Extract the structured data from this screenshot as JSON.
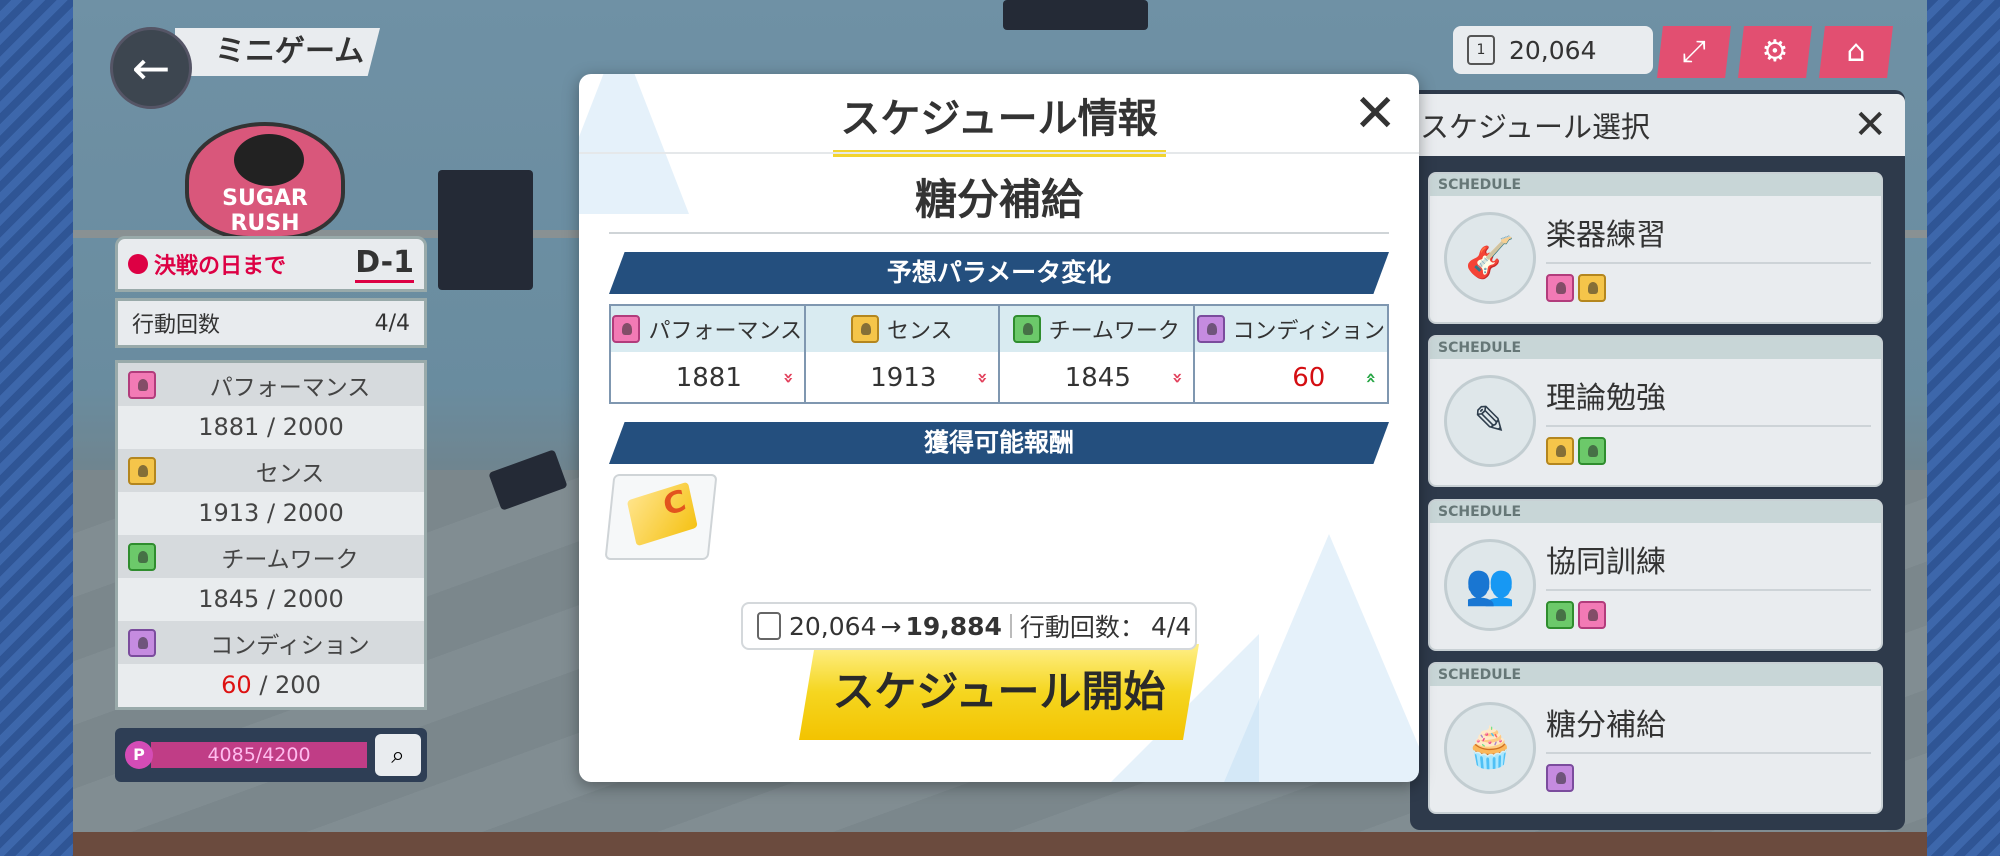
{
  "header": {
    "back_icon": "back-arrow-icon",
    "title": "ミニゲーム",
    "logo_text": "SUGAR RUSH"
  },
  "status": {
    "deadline_label": "決戦の日まで",
    "deadline_value": "D-1",
    "actions_label": "行動回数",
    "actions_value": "4/4",
    "stats": [
      {
        "label": "パフォーマンス",
        "current": "1881",
        "max": "2000"
      },
      {
        "label": "センス",
        "current": "1913",
        "max": "2000"
      },
      {
        "label": "チームワーク",
        "current": "1845",
        "max": "2000"
      },
      {
        "label": "コンディション",
        "current": "60",
        "max": "200"
      }
    ],
    "points_icon_label": "P",
    "points_value": "4085/4200",
    "points_progress": 0.9726
  },
  "top_right": {
    "currency": "20,064",
    "buttons": [
      "expand-icon",
      "gear-icon",
      "home-icon"
    ]
  },
  "schedule_select": {
    "title": "スケジュール選択",
    "tag": "SCHEDULE",
    "items": [
      {
        "name": "楽器練習",
        "icon": "guitar-icon",
        "params": [
          "performance",
          "sense"
        ]
      },
      {
        "name": "理論勉強",
        "icon": "book-pen-icon",
        "params": [
          "sense",
          "teamwork"
        ]
      },
      {
        "name": "協同訓練",
        "icon": "people-icon",
        "params": [
          "teamwork",
          "performance"
        ]
      },
      {
        "name": "糖分補給",
        "icon": "cupcake-icon",
        "params": [
          "condition"
        ]
      }
    ]
  },
  "modal": {
    "title": "スケジュール情報",
    "schedule_name": "糖分補給",
    "param_banner": "予想パラメータ変化",
    "params": [
      {
        "label": "パフォーマンス",
        "value": "1881",
        "trend": "down"
      },
      {
        "label": "センス",
        "value": "1913",
        "trend": "down"
      },
      {
        "label": "チームワーク",
        "value": "1845",
        "trend": "down"
      },
      {
        "label": "コンディション",
        "value": "60",
        "trend": "up"
      }
    ],
    "reward_banner": "獲得可能報酬",
    "reward_item_letter": "C",
    "cost_from": "20,064",
    "cost_to": "19,884",
    "cost_actions_label": "行動回数：",
    "cost_actions_value": "4/4",
    "start_label": "スケジュール開始"
  },
  "colors": {
    "performance": "#f27ab5",
    "sense": "#f5c54a",
    "teamwork": "#6cc96a",
    "condition": "#c58be0",
    "banner": "#244f7e",
    "accent_red": "#e24f71",
    "start_button": "#f5d620"
  }
}
